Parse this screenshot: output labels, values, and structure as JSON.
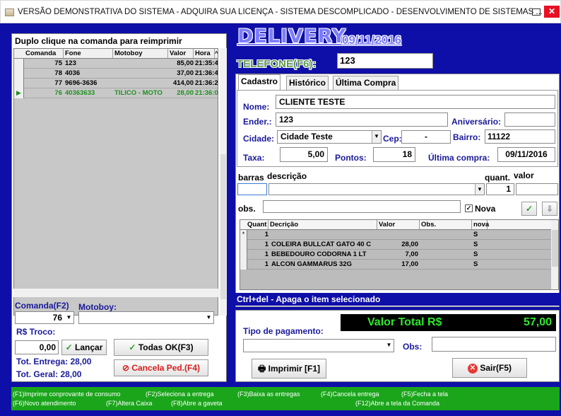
{
  "window": {
    "title": "VERSÃO DEMONSTRATIVA DO SISTEMA - ADQUIRA SUA LICENÇA - SISTEMA DESCOMPLICADO - DESENVOLVIMENTO DE SISTEMAS ...",
    "min": "–",
    "close": "✕"
  },
  "left": {
    "header": "Duplo clique na comanda para reimprimir",
    "columns": [
      "Comanda",
      "Fone",
      "Motoboy",
      "Valor",
      "Hora"
    ],
    "rows": [
      {
        "comanda": "75",
        "fone": "123",
        "motoboy": "",
        "valor": "85,00",
        "hora": "21:35:4"
      },
      {
        "comanda": "78",
        "fone": "4036",
        "motoboy": "",
        "valor": "37,00",
        "hora": "21:36:4"
      },
      {
        "comanda": "77",
        "fone": "9696-3636",
        "motoboy": "",
        "valor": "414,00",
        "hora": "21:36:2"
      },
      {
        "comanda": "76",
        "fone": "40363633",
        "motoboy": "TILICO - MOTO",
        "valor": "28,00",
        "hora": "21:36:0"
      }
    ],
    "comanda_label": "Comanda(F2)",
    "comanda_value": "76",
    "motoboy_label": "Motoboy:",
    "motoboy_value": "",
    "troco_label": "R$ Troco:",
    "troco_value": "0,00",
    "lancar": "Lançar",
    "todas_ok": "Todas OK(F3)",
    "tot_entrega": "Tot. Entrega: 28,00",
    "tot_geral": "Tot. Geral: 28,00",
    "cancela": "Cancela Ped.(F4)"
  },
  "header": {
    "delivery": "DELIVERY",
    "date": "09/11/2016",
    "telefone_label": "TELEFONE(F6):",
    "telefone_value": "123"
  },
  "tabs": [
    "Cadastro",
    "Histórico",
    "Última Compra"
  ],
  "cadastro": {
    "nome_label": "Nome:",
    "nome": "CLIENTE TESTE",
    "ender_label": "Ender.:",
    "ender": "123",
    "aniversario_label": "Aniversário:",
    "aniversario": "",
    "cidade_label": "Cidade:",
    "cidade": "Cidade Teste",
    "cep_label": "Cep:",
    "cep": "-",
    "bairro_label": "Bairro:",
    "bairro": "11122",
    "taxa_label": "Taxa:",
    "taxa": "5,00",
    "pontos_label": "Pontos:",
    "pontos": "18",
    "ultima_label": "Última compra:",
    "ultima": "09/11/2016"
  },
  "items": {
    "barras_label": "barras",
    "descricao_label": "descrição",
    "quant_label": "quant.",
    "valor_label": "valor",
    "quant_value": "1",
    "obs_label": "obs.",
    "nova_label": "Nova",
    "columns": [
      "Quant",
      "Decrição",
      "Valor",
      "Obs.",
      "nova"
    ],
    "rows": [
      {
        "quant": "1",
        "desc": "",
        "valor": "",
        "obs": "",
        "nova": "S"
      },
      {
        "quant": "1",
        "desc": "COLEIRA BULLCAT GATO 40 C",
        "valor": "28,00",
        "obs": "",
        "nova": "S"
      },
      {
        "quant": "1",
        "desc": "BEBEDOURO CODORNA 1 LT",
        "valor": "7,00",
        "obs": "",
        "nova": "S"
      },
      {
        "quant": "1",
        "desc": "ALCON GAMMARUS 32G",
        "valor": "17,00",
        "obs": "",
        "nova": "S"
      }
    ],
    "ctrl_hint": "Ctrl+del - Apaga o item selecionado"
  },
  "payment": {
    "total_label": "Valor Total R$",
    "total_value": "57,00",
    "tipo_label": "Tipo de pagamento:",
    "obs_label": "Obs:",
    "imprimir": "Imprimir [F1]",
    "sair": "Sair(F5)"
  },
  "footer": {
    "f1": "(F1)Imprime conprovante de consumo",
    "f2": "(F2)Seleciona a entrega",
    "f3": "(F3)Baixa as entregas",
    "f4": "(F4)Cancela entrega",
    "f5": "(F5)Fecha a tela",
    "f6": "(F6)Novo atendimento",
    "f7": "(F7)Altera Caixa",
    "f8": "(F8)Abre a gaveta",
    "f12": "(F12)Abre a tela da Comanda"
  }
}
